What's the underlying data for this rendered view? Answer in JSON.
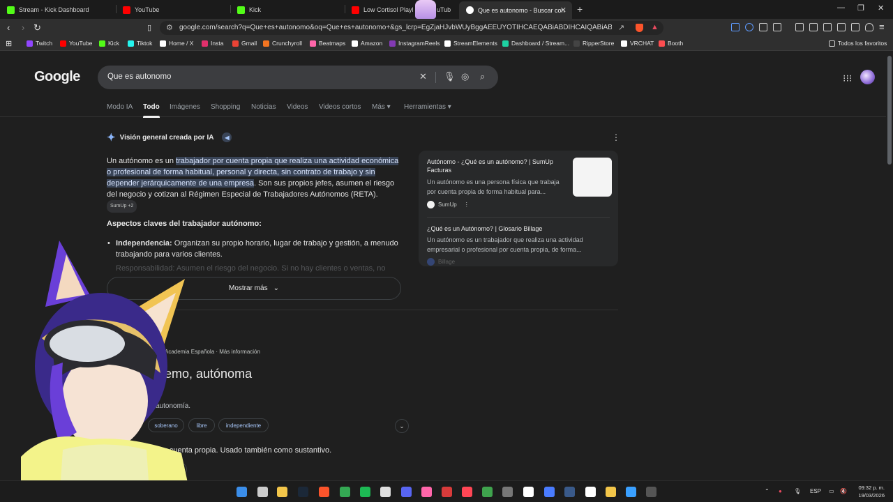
{
  "tabs": [
    {
      "title": "Stream - Kick Dashboard",
      "color": "#53fc18"
    },
    {
      "title": "YouTube",
      "color": "#ff0000"
    },
    {
      "title": "Kick",
      "color": "#53fc18"
    },
    {
      "title": "Low Cortisol Playlist",
      "color": "#ff0000"
    },
    {
      "title": "Que es autonomo - Buscar con G",
      "color": "#4285f4"
    }
  ],
  "tab_partial": "uTub",
  "address_url": "google.com/search?q=Que+es+autonomo&oq=Que+es+autonomo+&gs_lcrp=EgZjaHJvbWUyBggAEEUYOTIHCAEQABiABDIHCAIQABiABDIHCAMQ...",
  "bookmarks": [
    {
      "label": "Twitch",
      "color": "#9146ff"
    },
    {
      "label": "YouTube",
      "color": "#ff0000"
    },
    {
      "label": "Kick",
      "color": "#53fc18"
    },
    {
      "label": "Tiktok",
      "color": "#25f4ee"
    },
    {
      "label": "Home / X",
      "color": "#ffffff"
    },
    {
      "label": "Insta",
      "color": "#e1306c"
    },
    {
      "label": "Gmail",
      "color": "#ea4335"
    },
    {
      "label": "Crunchyroll",
      "color": "#f47521"
    },
    {
      "label": "Beatmaps",
      "color": "#ff66aa"
    },
    {
      "label": "Amazon",
      "color": "#ffffff"
    },
    {
      "label": "InstagramReels",
      "color": "#833ab4"
    },
    {
      "label": "StreamElements",
      "color": "#ffffff"
    },
    {
      "label": "Dashboard / Stream...",
      "color": "#1dd1a1"
    },
    {
      "label": "RipperStore",
      "color": "#444444"
    },
    {
      "label": "VRCHAT",
      "color": "#ffffff"
    },
    {
      "label": "Booth",
      "color": "#fc4d50"
    }
  ],
  "bookmarks_all": "Todos los favoritos",
  "google": {
    "logo": "Google",
    "query": "Que es autonomo",
    "filters": [
      "Modo IA",
      "Todo",
      "Imágenes",
      "Shopping",
      "Noticias",
      "Videos",
      "Videos cortos",
      "Más ▾",
      "Herramientas ▾"
    ],
    "active_filter_index": 1
  },
  "ai_overview": {
    "heading": "Visión general creada por IA",
    "para_start": "Un autónomo es un ",
    "para_highlight": "trabajador por cuenta propia que realiza una actividad económica o profesional de forma habitual, personal y directa, sin contrato de trabajo y sin depender jerárquicamente de una empresa",
    "para_end": ". Son sus propios jefes, asumen el riesgo del negocio y cotizan al Régimen Especial de Trabajadores Autónomos (RETA). ",
    "source_chip": "SumUp +2",
    "subheading": "Aspectos claves del trabajador autónomo:",
    "bullet_term": "Independencia:",
    "bullet_text": " Organizan su propio horario, lugar de trabajo y gestión, a menudo trabajando para varios clientes.",
    "faded_line": "Responsabilidad: Asumen el riesgo del negocio. Si no hay clientes o ventas, no",
    "more_button": "Mostrar más"
  },
  "sources": [
    {
      "title": "Autónomo - ¿Qué es un autónomo? | SumUp Facturas",
      "snippet": "Un autónomo es una persona física que trabaja por cuenta propia de forma habitual para...",
      "site": "SumUp"
    },
    {
      "title": "¿Qué es un Autónomo? | Glosario Billage",
      "snippet": "Un autónomo es un trabajador que realiza una actividad empresarial o profesional por cuenta propia, de forma...",
      "site": "Billage"
    }
  ],
  "dictionary": {
    "source": "Academia Española · Más información",
    "word": "emo, autónoma",
    "synonym_line": "autonomía.",
    "chips": [
      "soberano",
      "libre",
      "independiente"
    ],
    "definition": "or cuenta propia. Usado también como sustantivo.",
    "chip2": "ndiente"
  },
  "taskbar": {
    "lang": "ESP",
    "time": "09:32 p. m.",
    "date": "19/03/2026"
  }
}
